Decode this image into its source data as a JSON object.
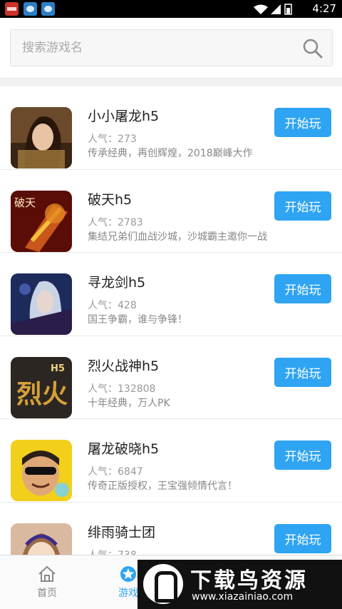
{
  "status_bar": {
    "time": "4:27"
  },
  "search": {
    "placeholder": "搜索游戏名"
  },
  "games": [
    {
      "name": "小小屠龙h5",
      "popularity": "人气：273",
      "description": "传承经典，再创辉煌，2018巅峰大作",
      "button": "开始玩"
    },
    {
      "name": "破天h5",
      "popularity": "人气：2783",
      "description": "集结兄弟们血战沙城，沙城霸主邀你一战",
      "button": "开始玩"
    },
    {
      "name": "寻龙剑h5",
      "popularity": "人气：428",
      "description": "国王争霸，谁与争锋！",
      "button": "开始玩"
    },
    {
      "name": "烈火战神h5",
      "popularity": "人气：132808",
      "description": "十年经典，万人PK",
      "button": "开始玩"
    },
    {
      "name": "屠龙破晓h5",
      "popularity": "人气：6847",
      "description": "传奇正版授权，王宝强倾情代言！",
      "button": "开始玩"
    },
    {
      "name": "绯雨骑士团",
      "popularity": "人气：738",
      "description": "",
      "button": "开始玩"
    }
  ],
  "icon_art": {
    "game0": {
      "text": ""
    },
    "game1": {
      "text": "破天"
    },
    "game3": {
      "text": "烈火",
      "badge": "H5"
    }
  },
  "tabs": {
    "home": "首页",
    "games": "游戏"
  },
  "watermark": {
    "title": "下载鸟资源",
    "url": "www.xiazainiao.com"
  },
  "colors": {
    "accent": "#2fa4f3",
    "statusbar": "#000000"
  }
}
